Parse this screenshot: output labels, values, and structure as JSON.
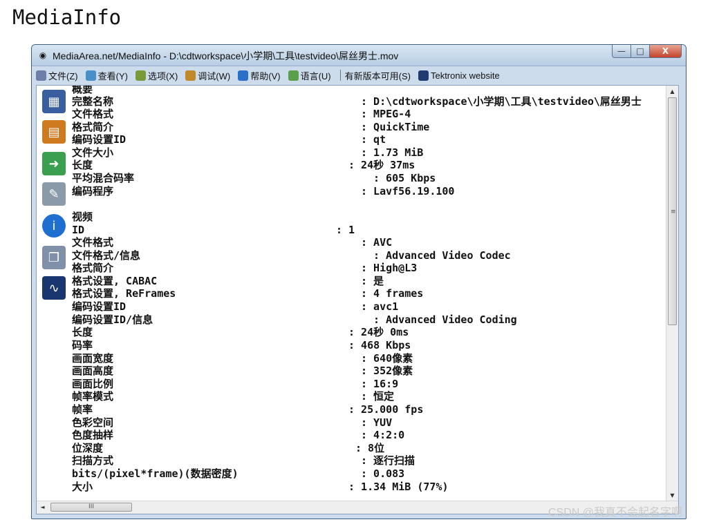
{
  "page": {
    "title": "MediaInfo"
  },
  "window": {
    "title": "MediaArea.net/MediaInfo - D:\\cdtworkspace\\小学期\\工具\\testvideo\\屌丝男士.mov",
    "icon": "speaker-icon",
    "buttons": {
      "minimize": "—",
      "maximize": "□",
      "close": "X"
    }
  },
  "menu": [
    {
      "label": "文件(Z)",
      "icon": "file-icon",
      "color": "#6d7fa8"
    },
    {
      "label": "查看(Y)",
      "icon": "view-icon",
      "color": "#4a90c8"
    },
    {
      "label": "选项(X)",
      "icon": "options-icon",
      "color": "#7a9a3a"
    },
    {
      "label": "调试(W)",
      "icon": "debug-icon",
      "color": "#c08a2a"
    },
    {
      "label": "帮助(V)",
      "icon": "help-icon",
      "color": "#2a6fc8"
    },
    {
      "label": "语言(U)",
      "icon": "language-icon",
      "color": "#5aa04a"
    },
    {
      "label": "有新版本可用(S)",
      "icon": "",
      "color": ""
    },
    {
      "label": "Tektronix website",
      "icon": "tektronix-icon",
      "color": "#1f3b70"
    }
  ],
  "sidebar": [
    {
      "name": "sheet-view-icon",
      "color": "#3a5fa0",
      "glyph": "▦"
    },
    {
      "name": "tree-view-icon",
      "color": "#d07a20",
      "glyph": "▤"
    },
    {
      "name": "export-icon",
      "color": "#3aa050",
      "glyph": "➜"
    },
    {
      "name": "preferences-icon",
      "color": "#8a9aa8",
      "glyph": "✎"
    },
    {
      "name": "about-icon",
      "color": "#1f6fd0",
      "glyph": "i"
    },
    {
      "name": "batch-icon",
      "color": "#8090a8",
      "glyph": "❐"
    },
    {
      "name": "tektronix-logo-icon",
      "color": "#1a3670",
      "glyph": "∿"
    }
  ],
  "lines": [
    {
      "label": "概要",
      "value": ""
    },
    {
      "label": "完整名称",
      "value": ": D:\\cdtworkspace\\小学期\\工具\\testvideo\\屌丝男士"
    },
    {
      "label": "文件格式",
      "value": ": MPEG-4"
    },
    {
      "label": "格式简介",
      "value": ": QuickTime"
    },
    {
      "label": "编码设置ID",
      "value": ": qt"
    },
    {
      "label": "文件大小",
      "value": ": 1.73 MiB"
    },
    {
      "label": "长度",
      "value": ": 24秒 37ms"
    },
    {
      "label": "平均混合码率",
      "value": ": 605 Kbps"
    },
    {
      "label": "编码程序",
      "value": ": Lavf56.19.100"
    },
    {
      "label": "",
      "value": ""
    },
    {
      "label": "视频",
      "value": ""
    },
    {
      "label": "ID",
      "value": ": 1"
    },
    {
      "label": "文件格式",
      "value": ": AVC"
    },
    {
      "label": "文件格式/信息",
      "value": ": Advanced Video Codec"
    },
    {
      "label": "格式简介",
      "value": ": High@L3"
    },
    {
      "label": "格式设置, CABAC",
      "value": ": 是"
    },
    {
      "label": "格式设置, ReFrames",
      "value": ": 4 frames"
    },
    {
      "label": "编码设置ID",
      "value": ": avc1"
    },
    {
      "label": "编码设置ID/信息",
      "value": ": Advanced Video Coding"
    },
    {
      "label": "长度",
      "value": ": 24秒 0ms"
    },
    {
      "label": "码率",
      "value": ": 468 Kbps"
    },
    {
      "label": "画面宽度",
      "value": ": 640像素"
    },
    {
      "label": "画面高度",
      "value": ": 352像素"
    },
    {
      "label": "画面比例",
      "value": ": 16:9"
    },
    {
      "label": "帧率模式",
      "value": ": 恒定"
    },
    {
      "label": "帧率",
      "value": ": 25.000 fps"
    },
    {
      "label": "色彩空间",
      "value": ": YUV"
    },
    {
      "label": "色度抽样",
      "value": ": 4:2:0"
    },
    {
      "label": "位深度",
      "value": ": 8位"
    },
    {
      "label": "扫描方式",
      "value": ": 逐行扫描"
    },
    {
      "label": "bits/(pixel*frame)(数据密度)",
      "value": ": 0.083"
    },
    {
      "label": "大小",
      "value": ": 1.34 MiB (77%)"
    }
  ],
  "scroll": {
    "v_up": "▲",
    "v_down": "▼",
    "v_grip": "≡",
    "h_left": "◄",
    "h_right": "►",
    "h_grip": "III"
  },
  "watermark": "CSDN @我真不会起名字啊"
}
